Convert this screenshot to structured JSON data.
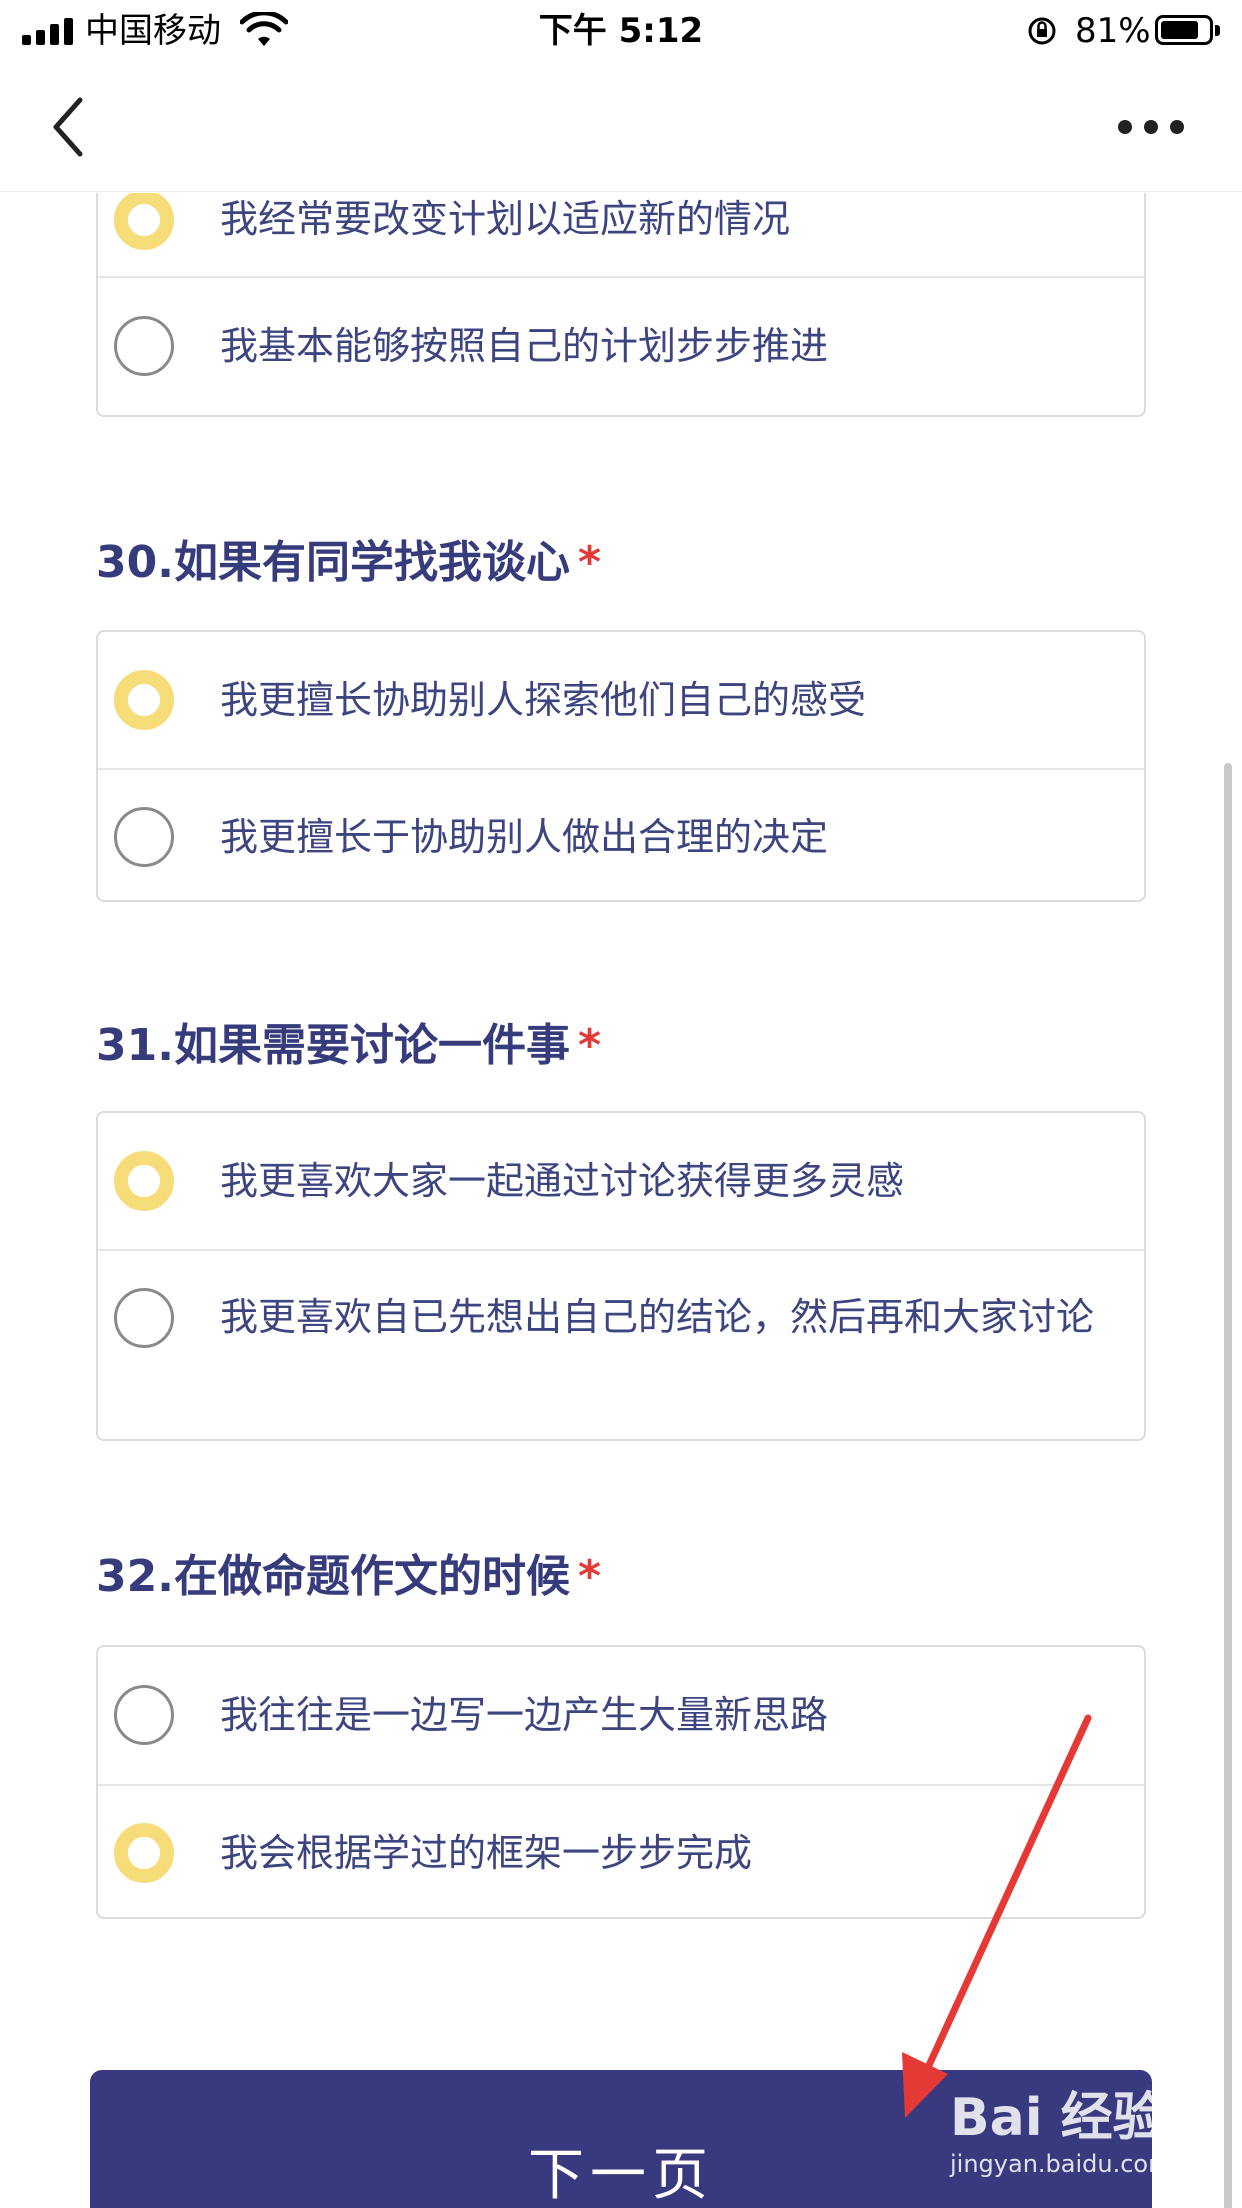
{
  "status_bar": {
    "carrier": "中国移动",
    "time": "下午 5:12",
    "battery_percent": "81%",
    "battery_level": 0.81
  },
  "nav": {
    "back_icon": "chevron-left-icon",
    "more_icon": "more-dots-icon"
  },
  "partial_question": {
    "options": [
      {
        "label": "我经常要改变计划以适应新的情况",
        "selected": true
      },
      {
        "label": "我基本能够按照自己的计划步步推进",
        "selected": false
      }
    ]
  },
  "questions": [
    {
      "title": "30.如果有同学找我谈心",
      "required_mark": "*",
      "options": [
        {
          "label": "我更擅长协助别人探索他们自己的感受",
          "selected": true
        },
        {
          "label": "我更擅长于协助别人做出合理的决定",
          "selected": false
        }
      ]
    },
    {
      "title": "31.如果需要讨论一件事",
      "required_mark": "*",
      "options": [
        {
          "label": "我更喜欢大家一起通过讨论获得更多灵感",
          "selected": true
        },
        {
          "label": "我更喜欢自已先想出自己的结论，然后再和大家讨论",
          "selected": false
        }
      ]
    },
    {
      "title": "32.在做命题作文的时候",
      "required_mark": "*",
      "options": [
        {
          "label": "我往往是一边写一边产生大量新思路",
          "selected": false
        },
        {
          "label": "我会根据学过的框架一步步完成",
          "selected": true
        }
      ]
    }
  ],
  "next_button": {
    "label": "下一页"
  },
  "watermark": {
    "logo": "Bai 经验",
    "sub": "jingyan.baidu.com"
  },
  "colors": {
    "accent": "#38397e",
    "selected_radio": "#f7dc7a",
    "required": "#e53935",
    "annotation_arrow": "#e53935"
  }
}
